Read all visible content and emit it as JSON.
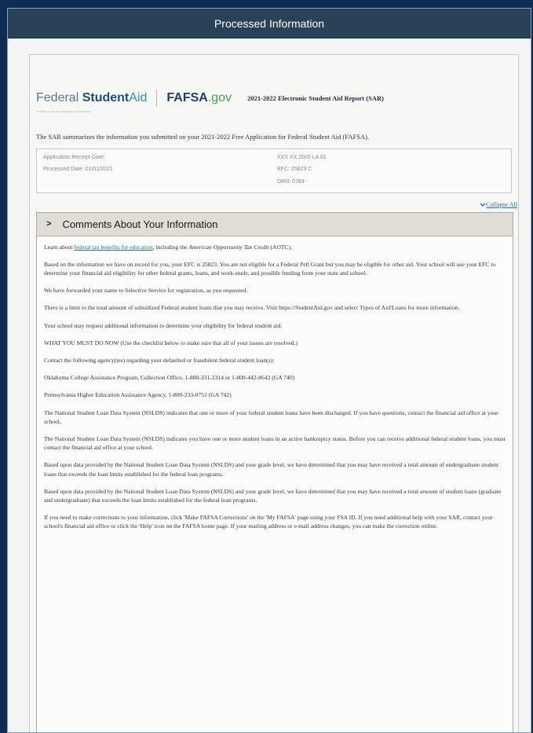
{
  "window": {
    "title": "Processed Information"
  },
  "header": {
    "fsa_logo": {
      "part1": "Federal ",
      "part2": "Student",
      "part3": "Aid",
      "tagline": "An Office of the U.S. Department of Education"
    },
    "fafsa_logo": {
      "part1": "FAFSA",
      "part2": ".gov"
    },
    "report_title": "2021-2022 Electronic Student Aid Report (SAR)"
  },
  "intro_text": "The SAR summarizes the information you submitted on your 2021-2022 Free Application for Federal Student Aid (FAFSA).",
  "info": {
    "receipt_label": "Application Receipt Date:",
    "processed": "Processed Date: 01/01/2021",
    "id_line": "XXX XX 2020 LA 01",
    "efc": "EFC: 25823 C",
    "drn": "DRN: 0783"
  },
  "collapse": {
    "icon": "chevron-down-icon",
    "label": "Collapse All"
  },
  "section": {
    "chevron": ">",
    "title": "Comments About Your Information",
    "learn": {
      "prefix": "Learn about ",
      "link": "federal tax benefits for education",
      "middle": ", including the ",
      "italic": "American Opportunity Tax Credit",
      "suffix": " (AOTC)."
    },
    "paragraphs": [
      "Based on the information we have on record for you, your EFC is 25823. You are not eligible for a Federal Pell Grant but you may be eligible for other aid. Your school will use your EFC to determine your financial aid eligibility for other federal grants, loans, and work-study, and possible funding from your state and school.",
      "We have forwarded your name to Selective Service for registration, as you requested.",
      "There is a limit to the total amount of subsidized Federal student loans that you may receive. Visit https://StudentAid.gov and select Types of Aid/Loans for more information.",
      "Your school may request additional information to determine your eligibility for federal student aid.",
      "WHAT YOU MUST DO NOW (Use the checklist below to make sure that all of your issues are resolved.)",
      "Contact the following agency(ies) regarding your defaulted or fraudulent federal student loan(s):",
      "Oklahoma College Assistance Program, Collection Office, 1-800-331-2314 or 1-800-442-8642 (GA 740)",
      "Pennsylvania Higher Education Assistance Agency, 1-800-233-0751 (GA 742)",
      "The National Student Loan Data System (NSLDS) indicates that one or more of your federal student loans have been discharged. If you have questions, contact the financial aid office at your school.",
      "The National Student Loan Data System (NSLDS) indicates you have one or more student loans in an active bankruptcy status. Before you can receive additional federal student loans, you must contact the financial aid office at your school.",
      "Based upon data provided by the National Student Loan Data System (NSLDS) and your grade level, we have determined that you may have received a total amount of undergraduate student loans that exceeds the loan limits established for the federal loan programs.",
      "Based upon data provided by the National Student Loan Data System (NSLDS) and your grade level, we have determined that you may have received a total amount of student loans (graduate and undergraduate) that exceeds the loan limits established for the federal loan programs.",
      "If you need to make corrections to your information, click 'Make FAFSA Corrections' on the 'My FAFSA' page using your FSA ID. If you need additional help with your SAR, contact your school's financial aid office or click the 'Help' icon on the FAFSA home page. If your mailing address or e-mail address changes, you can make the correction online."
    ]
  }
}
